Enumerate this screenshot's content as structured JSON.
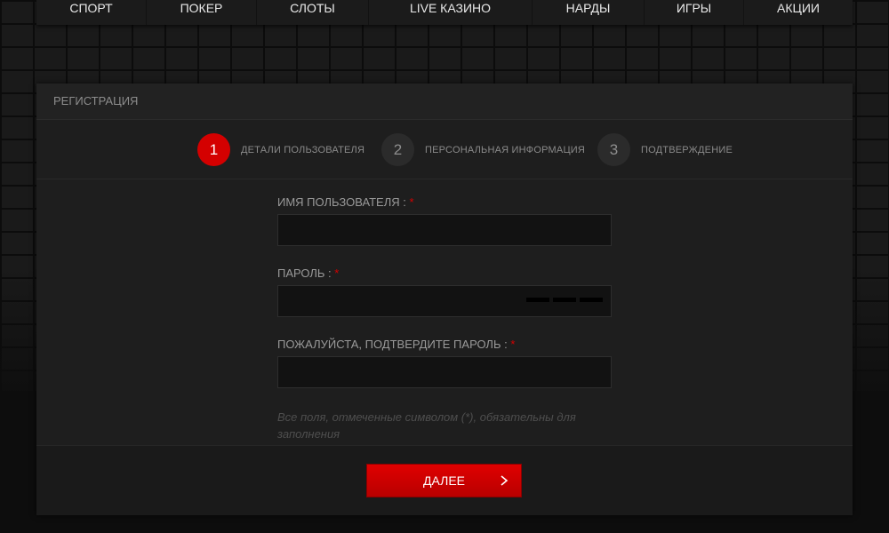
{
  "nav": {
    "items": [
      {
        "label": "СПОРТ"
      },
      {
        "label": "ПОКЕР"
      },
      {
        "label": "СЛОТЫ"
      },
      {
        "label": "LIVE КАЗИНО"
      },
      {
        "label": "НАРДЫ"
      },
      {
        "label": "ИГРЫ"
      },
      {
        "label": "АКЦИИ"
      }
    ]
  },
  "panel": {
    "title": "РЕГИСТРАЦИЯ"
  },
  "steps": [
    {
      "number": "1",
      "label": "ДЕТАЛИ ПОЛЬЗОВАТЕЛЯ",
      "active": true
    },
    {
      "number": "2",
      "label": "ПЕРСОНАЛЬНАЯ ИНФОРМАЦИЯ",
      "active": false
    },
    {
      "number": "3",
      "label": "ПОДТВЕРЖДЕНИЕ",
      "active": false
    }
  ],
  "form": {
    "username_label": "ИМЯ ПОЛЬЗОВАТЕЛЯ : ",
    "username_value": "",
    "password_label": "ПАРОЛЬ : ",
    "password_value": "",
    "confirm_label": "ПОЖАЛУЙСТА, ПОДТВЕРДИТЕ ПАРОЛЬ : ",
    "confirm_value": "",
    "required_mark": "*",
    "note": "Все поля, отмеченные символом (*), обязательны для заполнения"
  },
  "footer": {
    "next_label": "ДАЛЕЕ"
  },
  "colors": {
    "accent": "#d40000",
    "panel_bg": "#1e1e1e",
    "input_bg": "#121212"
  },
  "icons": {
    "next": "chevron-right-icon",
    "password_mask": "password-strength-icon"
  }
}
